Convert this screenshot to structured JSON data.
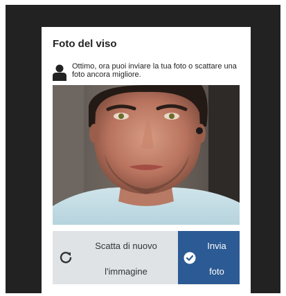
{
  "dialog": {
    "title": "Foto del viso",
    "message": "Ottimo, ora puoi inviare la tua foto o scattare una foto ancora migliore.",
    "photo_alt": "face-photo"
  },
  "actions": {
    "retake_label_line1": "Scatta di nuovo",
    "retake_label_line2": "l'immagine",
    "send_label_line1": "Invia",
    "send_label_line2": "foto"
  },
  "colors": {
    "backdrop": "#222222",
    "retake_bg": "#dfe3e6",
    "send_bg": "#2c5a94"
  },
  "icons": {
    "message": "user-icon",
    "retake": "refresh-icon",
    "send": "check-circle-icon"
  }
}
